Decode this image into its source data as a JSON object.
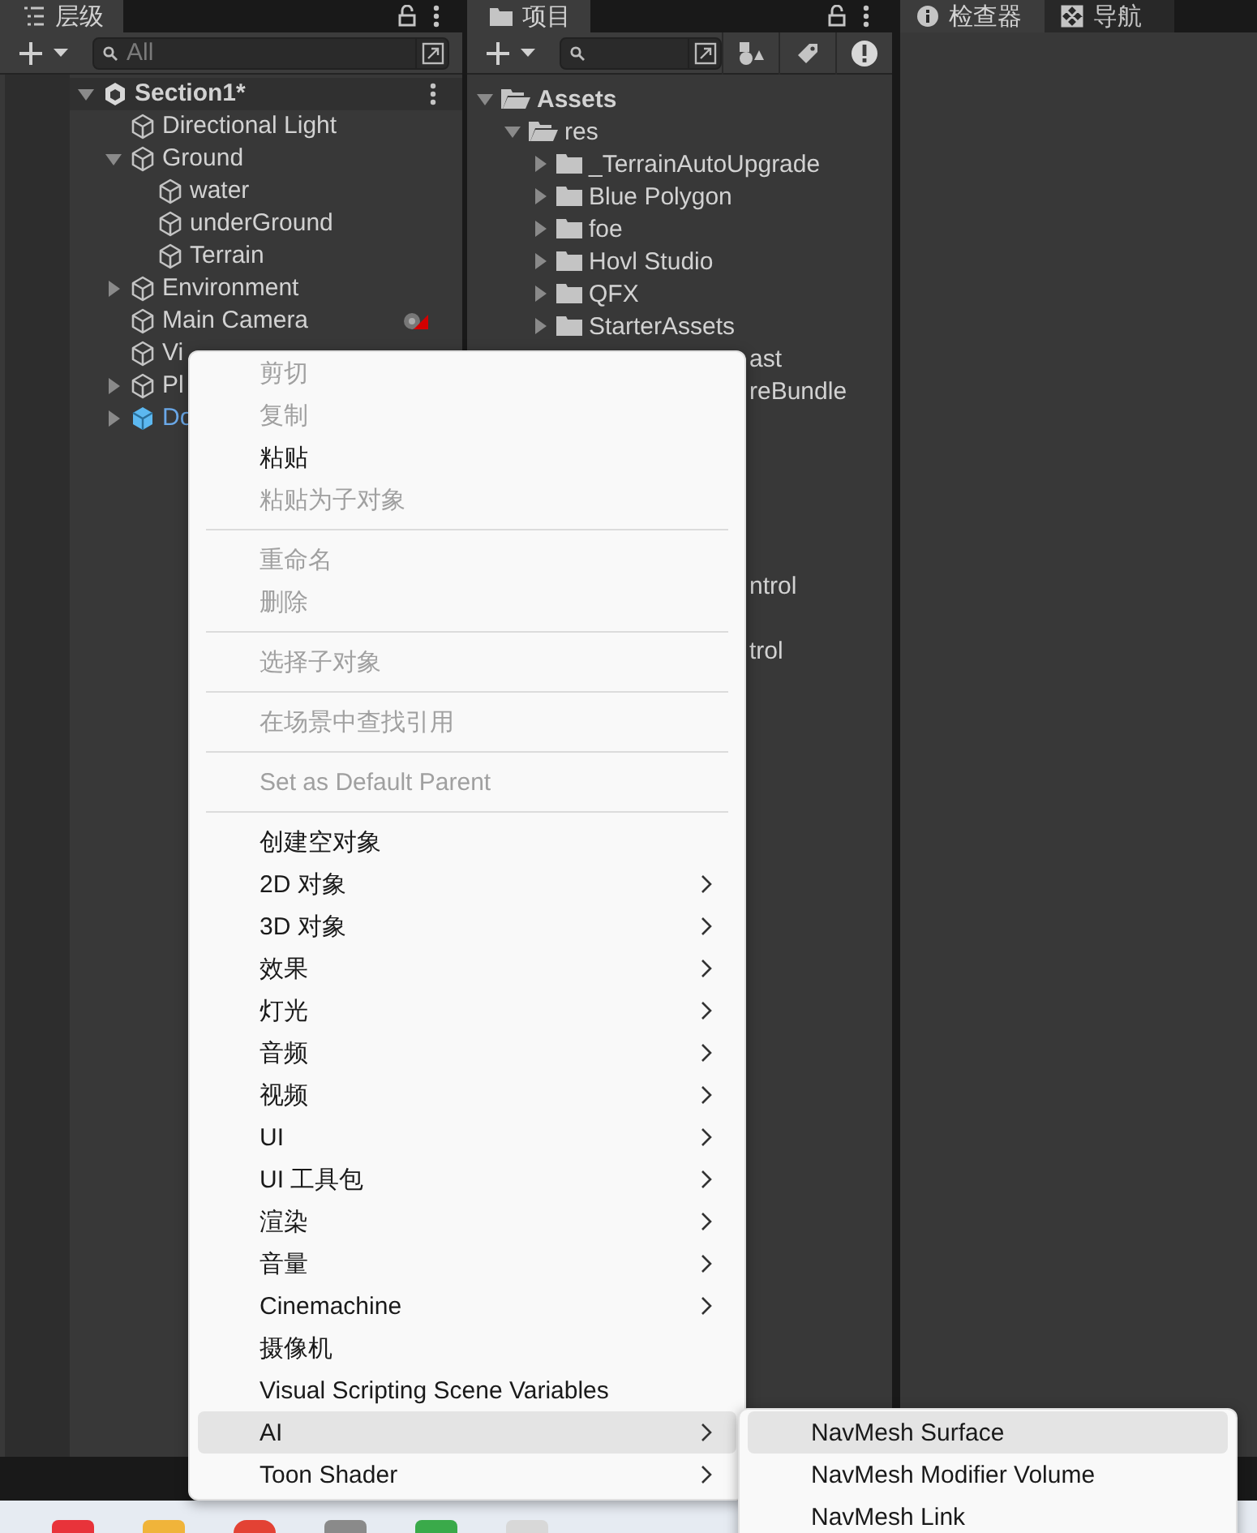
{
  "hierarchy": {
    "tab": {
      "label": "层级",
      "selected": true
    },
    "search": {
      "placeholder": "All"
    },
    "scene": {
      "label": "Section1*",
      "expanded": true,
      "children": [
        {
          "label": "Directional Light",
          "kind": "object"
        },
        {
          "label": "Ground",
          "kind": "object",
          "expanded": true,
          "children": [
            {
              "label": "water",
              "kind": "object"
            },
            {
              "label": "underGround",
              "kind": "object"
            },
            {
              "label": "Terrain",
              "kind": "object"
            }
          ]
        },
        {
          "label": "Environment",
          "kind": "object",
          "expanded": false
        },
        {
          "label": "Main Camera",
          "kind": "camera"
        },
        {
          "label": "Vi",
          "kind": "object"
        },
        {
          "label": "Pl",
          "kind": "object",
          "expanded": false
        },
        {
          "label": "Do",
          "kind": "prefab",
          "expanded": false
        }
      ]
    }
  },
  "project": {
    "tab": {
      "label": "项目",
      "selected": true
    },
    "tree": [
      {
        "label": "Assets",
        "expanded": true,
        "children": [
          {
            "label": "res",
            "expanded": true,
            "children": [
              {
                "label": "_TerrainAutoUpgrade",
                "expanded": false
              },
              {
                "label": "Blue Polygon",
                "expanded": false
              },
              {
                "label": "foe",
                "expanded": false
              },
              {
                "label": "Hovl Studio",
                "expanded": false
              },
              {
                "label": "QFX",
                "expanded": false
              },
              {
                "label": "StarterAssets",
                "expanded": false
              }
            ]
          }
        ]
      }
    ],
    "partial_rows": [
      "ast",
      "reBundle",
      "ntrol",
      "trol"
    ]
  },
  "inspector": {
    "tabs": [
      {
        "label": "检查器",
        "selected": true,
        "kind": "info"
      },
      {
        "label": "导航",
        "selected": false,
        "kind": "navigation"
      }
    ]
  },
  "context_menu": {
    "items": [
      {
        "kind": "item",
        "label": "剪切",
        "disabled": true,
        "submenu": false,
        "selected": false
      },
      {
        "kind": "item",
        "label": "复制",
        "disabled": true,
        "submenu": false,
        "selected": false
      },
      {
        "kind": "item",
        "label": "粘贴",
        "disabled": false,
        "submenu": false,
        "selected": false
      },
      {
        "kind": "item",
        "label": "粘贴为子对象",
        "disabled": true,
        "submenu": false,
        "selected": false
      },
      {
        "kind": "separator"
      },
      {
        "kind": "item",
        "label": "重命名",
        "disabled": true,
        "submenu": false,
        "selected": false
      },
      {
        "kind": "item",
        "label": "删除",
        "disabled": true,
        "submenu": false,
        "selected": false
      },
      {
        "kind": "separator"
      },
      {
        "kind": "item",
        "label": "选择子对象",
        "disabled": true,
        "submenu": false,
        "selected": false
      },
      {
        "kind": "separator"
      },
      {
        "kind": "item",
        "label": "在场景中查找引用",
        "disabled": true,
        "submenu": false,
        "selected": false
      },
      {
        "kind": "separator"
      },
      {
        "kind": "item",
        "label": "Set as Default Parent",
        "disabled": true,
        "submenu": false,
        "selected": false
      },
      {
        "kind": "separator"
      },
      {
        "kind": "item",
        "label": "创建空对象",
        "disabled": false,
        "submenu": false,
        "selected": false
      },
      {
        "kind": "item",
        "label": "2D 对象",
        "disabled": false,
        "submenu": true,
        "selected": false
      },
      {
        "kind": "item",
        "label": "3D 对象",
        "disabled": false,
        "submenu": true,
        "selected": false
      },
      {
        "kind": "item",
        "label": "效果",
        "disabled": false,
        "submenu": true,
        "selected": false
      },
      {
        "kind": "item",
        "label": "灯光",
        "disabled": false,
        "submenu": true,
        "selected": false
      },
      {
        "kind": "item",
        "label": "音频",
        "disabled": false,
        "submenu": true,
        "selected": false
      },
      {
        "kind": "item",
        "label": "视频",
        "disabled": false,
        "submenu": true,
        "selected": false
      },
      {
        "kind": "item",
        "label": "UI",
        "disabled": false,
        "submenu": true,
        "selected": false
      },
      {
        "kind": "item",
        "label": "UI 工具包",
        "disabled": false,
        "submenu": true,
        "selected": false
      },
      {
        "kind": "item",
        "label": "渲染",
        "disabled": false,
        "submenu": true,
        "selected": false
      },
      {
        "kind": "item",
        "label": "音量",
        "disabled": false,
        "submenu": true,
        "selected": false
      },
      {
        "kind": "item",
        "label": "Cinemachine",
        "disabled": false,
        "submenu": true,
        "selected": false
      },
      {
        "kind": "item",
        "label": "摄像机",
        "disabled": false,
        "submenu": false,
        "selected": false
      },
      {
        "kind": "item",
        "label": "Visual Scripting Scene Variables",
        "disabled": false,
        "submenu": false,
        "selected": false
      },
      {
        "kind": "item",
        "label": "AI",
        "disabled": false,
        "submenu": true,
        "selected": true
      },
      {
        "kind": "item",
        "label": "Toon Shader",
        "disabled": false,
        "submenu": true,
        "selected": false
      }
    ]
  },
  "submenu": {
    "items": [
      {
        "label": "NavMesh Surface",
        "selected": true
      },
      {
        "label": "NavMesh Modifier Volume",
        "selected": false
      },
      {
        "label": "NavMesh Link",
        "selected": false
      }
    ]
  }
}
